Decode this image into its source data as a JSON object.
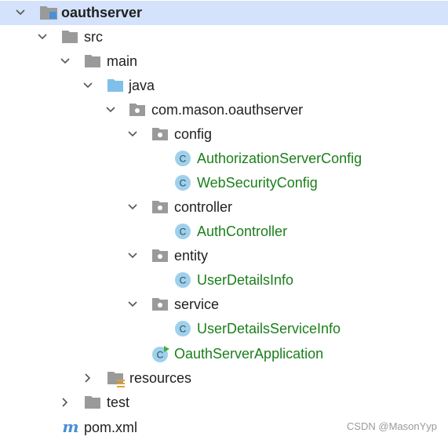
{
  "project": {
    "name": "oauthserver",
    "src": "src",
    "main": "main",
    "java": "java",
    "package": "com.mason.oauthserver",
    "config": {
      "folder": "config",
      "classes": [
        "AuthorizationServerConfig",
        "WebSecurityConfig"
      ]
    },
    "controller": {
      "folder": "controller",
      "classes": [
        "AuthController"
      ]
    },
    "entity": {
      "folder": "entity",
      "classes": [
        "UserDetailsInfo"
      ]
    },
    "service": {
      "folder": "service",
      "classes": [
        "UserDetailsServiceInfo"
      ]
    },
    "application": "OauthServerApplication",
    "resources": "resources",
    "test": "test",
    "pom": "pom.xml"
  },
  "watermark": "CSDN @MasonYyp",
  "colors": {
    "selection": "#d4e2fb",
    "class_text": "#1b7f1b",
    "class_icon": "#9fd0ec",
    "folder_gray": "#9a9a9a",
    "source_folder_blue": "#7ec0ea"
  }
}
